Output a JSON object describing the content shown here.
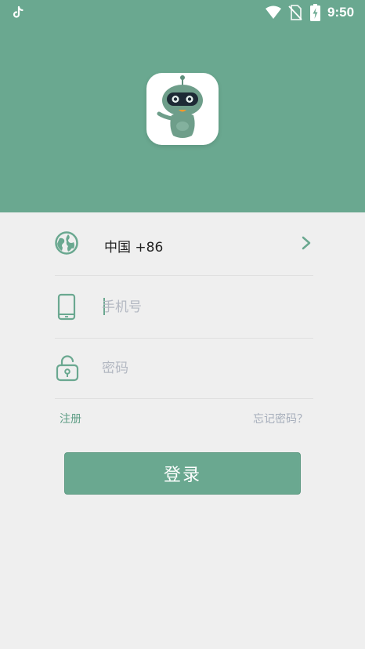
{
  "status_bar": {
    "app_icon": "tiktok-icon",
    "time": "9:50",
    "wifi_icon": "wifi-icon",
    "sim_icon": "no-sim-icon",
    "battery_icon": "battery-charging-icon"
  },
  "header": {
    "background_color": "#6aa890",
    "logo": "robot-mascot-logo"
  },
  "form": {
    "country": {
      "icon": "globe-icon",
      "label": "中国 +86",
      "chevron": "chevron-right-icon"
    },
    "phone": {
      "icon": "phone-icon",
      "placeholder": "手机号",
      "value": ""
    },
    "password": {
      "icon": "unlock-icon",
      "placeholder": "密码",
      "value": ""
    }
  },
  "links": {
    "register": "注册",
    "forgot_password": "忘记密码？"
  },
  "login_button": {
    "label": "登录"
  },
  "colors": {
    "accent": "#6aa890",
    "background": "#efefef",
    "placeholder": "#b3b8c2"
  }
}
